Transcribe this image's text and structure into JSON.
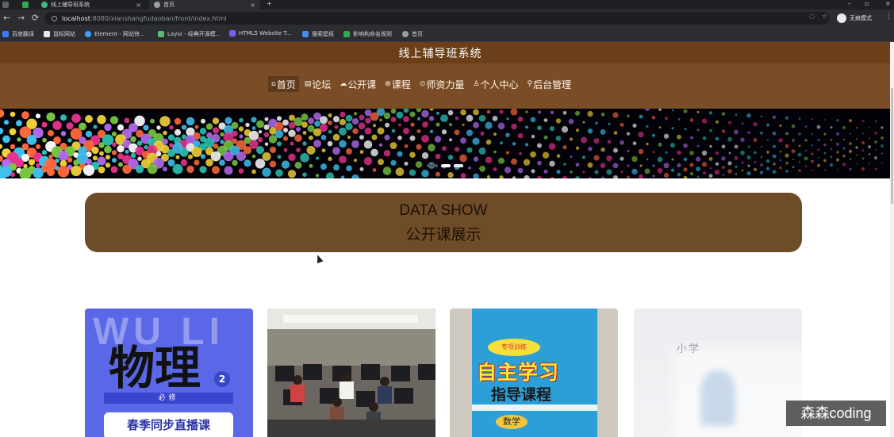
{
  "browser": {
    "tabs": [
      {
        "title": "线上辅导班系统",
        "favicon_color": "#41b883"
      },
      {
        "title": "首页",
        "favicon_color": "#9aa0a6",
        "active": true
      }
    ],
    "new_tab_symbol": "+",
    "url": {
      "host": "localhost",
      "path": ":8080/xianshangfudaoban/front/index.html"
    },
    "profile_label": "无痕模式",
    "bookmarks": [
      {
        "label": "百度翻译",
        "icon_color": "#3a7bf6"
      },
      {
        "label": "鼠标网站",
        "icon_color": "#e8eaed"
      },
      {
        "label": "Element - 网站快...",
        "icon_color": "#409eff"
      },
      {
        "label": "Layui - 经典开源模...",
        "icon_color": "#5fb878"
      },
      {
        "label": "HTML5 Website T...",
        "icon_color": "#7b5cf5"
      },
      {
        "label": "搜索壁纸",
        "icon_color": "#4a8af4"
      },
      {
        "label": "影响构命名规则",
        "icon_color": "#34a853"
      },
      {
        "label": "首页",
        "icon_color": "#9aa0a6"
      }
    ]
  },
  "header": {
    "site_title": "线上辅导班系统",
    "nav": [
      {
        "icon": "home-icon",
        "glyph": "⌂",
        "label": "首页",
        "active": true
      },
      {
        "icon": "forum-icon",
        "glyph": "▤",
        "label": "论坛"
      },
      {
        "icon": "course-icon",
        "glyph": "☁",
        "label": "公开课"
      },
      {
        "icon": "class-icon",
        "glyph": "⊛",
        "label": "课程"
      },
      {
        "icon": "teacher-icon",
        "glyph": "⊙",
        "label": "师资力量"
      },
      {
        "icon": "user-icon",
        "glyph": "♙",
        "label": "个人中心"
      },
      {
        "icon": "admin-icon",
        "glyph": "⚲",
        "label": "后台管理"
      }
    ]
  },
  "section": {
    "title_en": "DATA SHOW",
    "title_cn": "公开课展示"
  },
  "cards": [
    {
      "watermark": "WU LI",
      "title": "物理",
      "badge": "2",
      "tag": "必修",
      "subtitle": "春季同步直播课"
    },
    {},
    {
      "burst": "专项训练",
      "title": "自主学习",
      "subtitle": "指导课程",
      "subject": "数学"
    },
    {
      "text": "小学"
    }
  ],
  "overlay": {
    "watermark": "森森coding"
  },
  "colors": {
    "header": "#7b4d26",
    "section_box": "#6e4c27",
    "nav_active": "#5e3b1d"
  }
}
